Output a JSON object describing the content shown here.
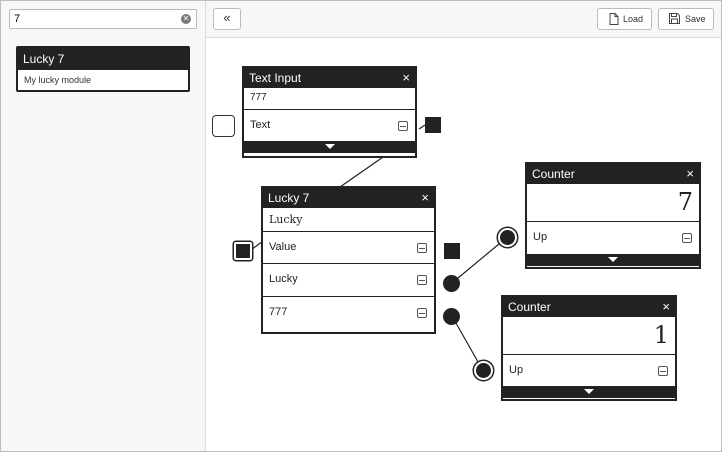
{
  "sidebar": {
    "search": {
      "value": "7",
      "clear_glyph": "✕"
    },
    "modules": [
      {
        "title": "Lucky 7",
        "description": "My lucky module"
      }
    ]
  },
  "toolbar": {
    "collapse_glyph": "«",
    "load_label": "Load",
    "save_label": "Save",
    "load_icon": "document-icon",
    "save_icon": "floppy-disk-icon"
  },
  "nodes": {
    "text_input": {
      "title": "Text Input",
      "value": "777",
      "rows": [
        "Text"
      ]
    },
    "lucky7": {
      "title": "Lucky 7",
      "subtitle": "Lucky",
      "rows": [
        "Value",
        "Lucky",
        "777"
      ]
    },
    "counter_a": {
      "title": "Counter",
      "value": "7",
      "rows": [
        "Up"
      ]
    },
    "counter_b": {
      "title": "Counter",
      "value": "1",
      "rows": [
        "Up"
      ]
    },
    "close_glyph": "×"
  },
  "colors": {
    "node_header": "#222222",
    "panel_bg": "#f7f7f7",
    "border": "#bdbdbd"
  }
}
